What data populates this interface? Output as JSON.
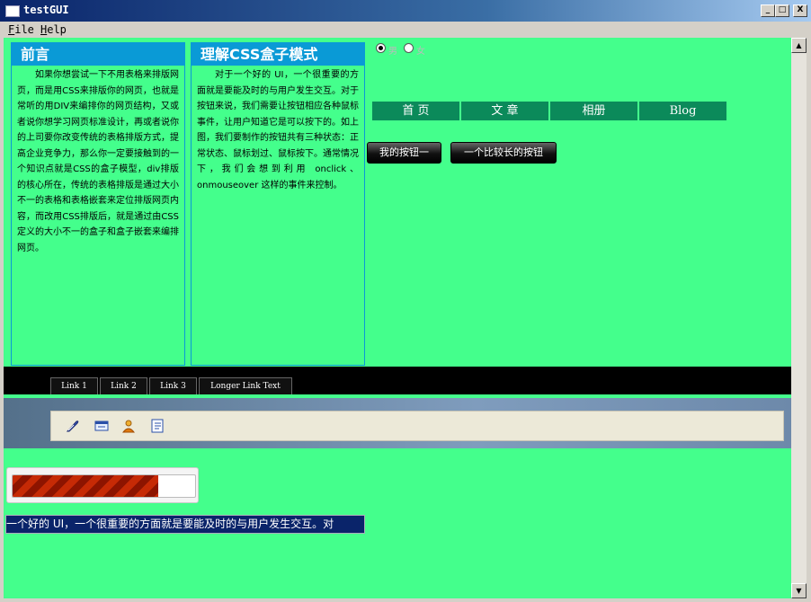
{
  "window": {
    "title": "testGUI",
    "min": "_",
    "max": "□",
    "close": "X"
  },
  "menu": {
    "file": "File",
    "help": "Help"
  },
  "box1": {
    "heading": "前言",
    "body": "如果你想尝试一下不用表格来排版网页，而是用CSS来排版你的网页，也就是常听的用DIV来编排你的网页结构，又或者说你想学习网页标准设计，再或者说你的上司要你改变传统的表格排版方式，提高企业竞争力，那么你一定要接触到的一个知识点就是CSS的盒子模型，div排版的核心所在，传统的表格排版是通过大小不一的表格和表格嵌套来定位排版网页内容，而改用CSS排版后，就是通过由CSS定义的大小不一的盒子和盒子嵌套来编排网页。"
  },
  "box2": {
    "heading": "理解CSS盒子模式",
    "body": "对于一个好的 UI，一个很重要的方面就是要能及时的与用户发生交互。对于按钮来说，我们需要让按钮相应各种鼠标事件，让用户知道它是可以按下的。如上图，我们要制作的按钮共有三种状态：正常状态、鼠标划过、鼠标按下。通常情况下，我们会想到利用 onclick、onmouseover 这样的事件来控制。"
  },
  "radios": {
    "male": "男",
    "female": "女",
    "selected": "male"
  },
  "nav": [
    "首 页",
    "文 章",
    "相册",
    "Blog"
  ],
  "buttons": {
    "first": "我的按钮一",
    "second": "一个比较长的按钮"
  },
  "links": [
    "Link 1",
    "Link 2",
    "Link 3",
    "Longer Link Text"
  ],
  "toolbar_icons": [
    "feather-pen-icon",
    "id-card-icon",
    "user-icon",
    "checklist-icon"
  ],
  "progress": {
    "value": 0.8
  },
  "marquee": {
    "text": "一个好的 UI，一个很重要的方面就是要能及时的与用户发生交互。对"
  },
  "colors": {
    "background": "#44ff8c",
    "box_header": "#0a9ad6",
    "nav": "#0b8a5a",
    "title_bar": "#0a246a"
  }
}
